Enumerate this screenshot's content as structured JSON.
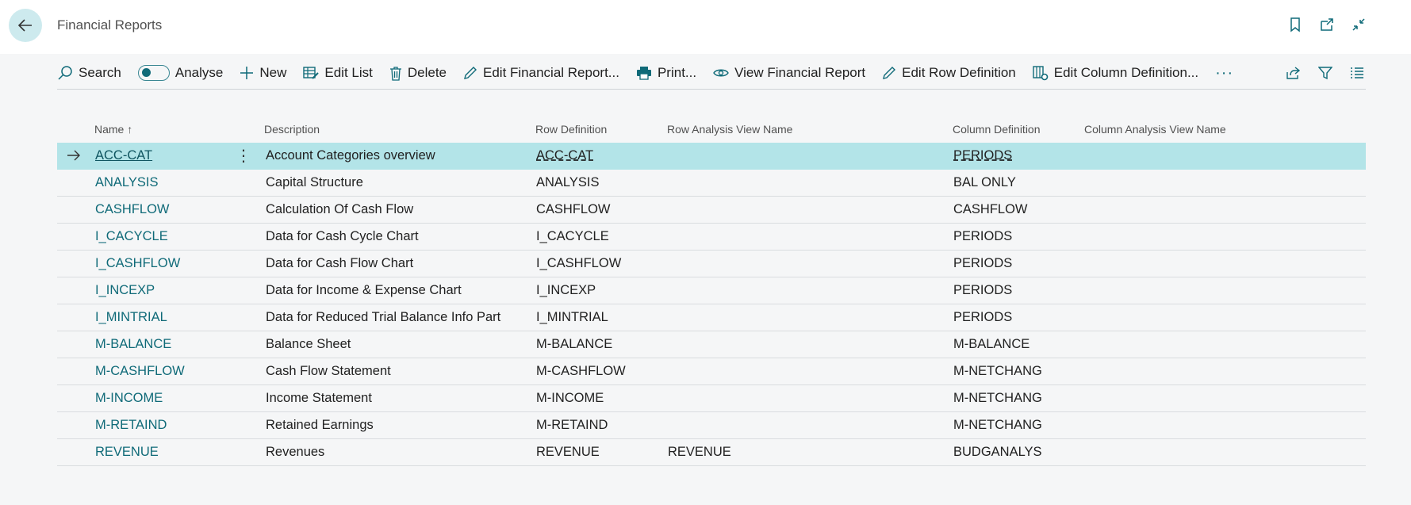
{
  "header": {
    "title": "Financial Reports",
    "icons": [
      "back-arrow-icon",
      "bookmark-icon",
      "open-new-window-icon",
      "collapse-icon"
    ]
  },
  "actions": {
    "search": "Search",
    "analyse": "Analyse",
    "new": "New",
    "edit_list": "Edit List",
    "delete": "Delete",
    "edit_financial_report": "Edit Financial Report...",
    "print": "Print...",
    "view_financial_report": "View Financial Report",
    "edit_row_definition": "Edit Row Definition",
    "edit_column_definition": "Edit Column Definition...",
    "more": "···",
    "right_icons": [
      "share-icon",
      "filter-icon",
      "list-view-icon"
    ]
  },
  "table": {
    "columns": {
      "name": "Name",
      "description": "Description",
      "row_definition": "Row Definition",
      "row_analysis_view": "Row Analysis View Name",
      "column_definition": "Column Definition",
      "column_analysis_view": "Column Analysis View Name"
    },
    "sort_indicator": "↑",
    "rows": [
      {
        "name": "ACC-CAT",
        "description": "Account Categories overview",
        "row_definition": "ACC-CAT",
        "row_analysis_view": "",
        "column_definition": "PERIODS",
        "column_analysis_view": ""
      },
      {
        "name": "ANALYSIS",
        "description": "Capital Structure",
        "row_definition": "ANALYSIS",
        "row_analysis_view": "",
        "column_definition": "BAL ONLY",
        "column_analysis_view": ""
      },
      {
        "name": "CASHFLOW",
        "description": "Calculation Of Cash Flow",
        "row_definition": "CASHFLOW",
        "row_analysis_view": "",
        "column_definition": "CASHFLOW",
        "column_analysis_view": ""
      },
      {
        "name": "I_CACYCLE",
        "description": "Data for Cash Cycle Chart",
        "row_definition": "I_CACYCLE",
        "row_analysis_view": "",
        "column_definition": "PERIODS",
        "column_analysis_view": ""
      },
      {
        "name": "I_CASHFLOW",
        "description": "Data for Cash Flow Chart",
        "row_definition": "I_CASHFLOW",
        "row_analysis_view": "",
        "column_definition": "PERIODS",
        "column_analysis_view": ""
      },
      {
        "name": "I_INCEXP",
        "description": "Data for Income & Expense Chart",
        "row_definition": "I_INCEXP",
        "row_analysis_view": "",
        "column_definition": "PERIODS",
        "column_analysis_view": ""
      },
      {
        "name": "I_MINTRIAL",
        "description": "Data for Reduced Trial Balance Info Part",
        "row_definition": "I_MINTRIAL",
        "row_analysis_view": "",
        "column_definition": "PERIODS",
        "column_analysis_view": ""
      },
      {
        "name": "M-BALANCE",
        "description": "Balance Sheet",
        "row_definition": "M-BALANCE",
        "row_analysis_view": "",
        "column_definition": "M-BALANCE",
        "column_analysis_view": ""
      },
      {
        "name": "M-CASHFLOW",
        "description": "Cash Flow Statement",
        "row_definition": "M-CASHFLOW",
        "row_analysis_view": "",
        "column_definition": "M-NETCHANG",
        "column_analysis_view": ""
      },
      {
        "name": "M-INCOME",
        "description": "Income Statement",
        "row_definition": "M-INCOME",
        "row_analysis_view": "",
        "column_definition": "M-NETCHANG",
        "column_analysis_view": ""
      },
      {
        "name": "M-RETAIND",
        "description": "Retained Earnings",
        "row_definition": "M-RETAIND",
        "row_analysis_view": "",
        "column_definition": "M-NETCHANG",
        "column_analysis_view": ""
      },
      {
        "name": "REVENUE",
        "description": "Revenues",
        "row_definition": "REVENUE",
        "row_analysis_view": "REVENUE",
        "column_definition": "BUDGANALYS",
        "column_analysis_view": ""
      }
    ],
    "selected_row_icon": "row-selected-arrow-icon",
    "row_menu_icon": "ellipsis-vertical-icon"
  },
  "colors": {
    "accent": "#0f6a78",
    "selected_row": "#b3e4e8",
    "back_button": "#cdeaee",
    "background": "#f5f6f7"
  }
}
